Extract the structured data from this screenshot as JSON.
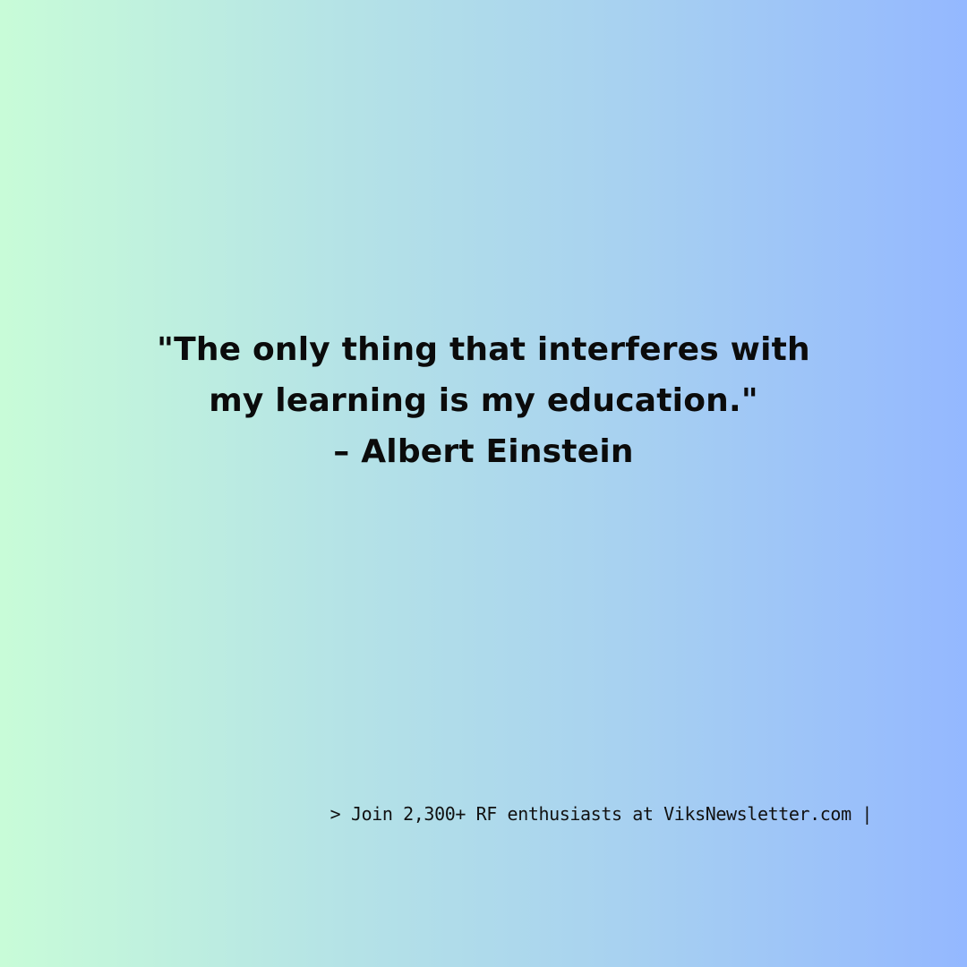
{
  "quote": {
    "line1": "\"The only thing that interferes with",
    "line2": "my learning is my education.\"",
    "attribution": "– Albert Einstein"
  },
  "footer": {
    "cta": "> Join 2,300+ RF enthusiasts at ViksNewsletter.com |"
  },
  "colors": {
    "gradient_start": "#c8fcd8",
    "gradient_end": "#94b8ff",
    "text": "#0b0b0b"
  }
}
